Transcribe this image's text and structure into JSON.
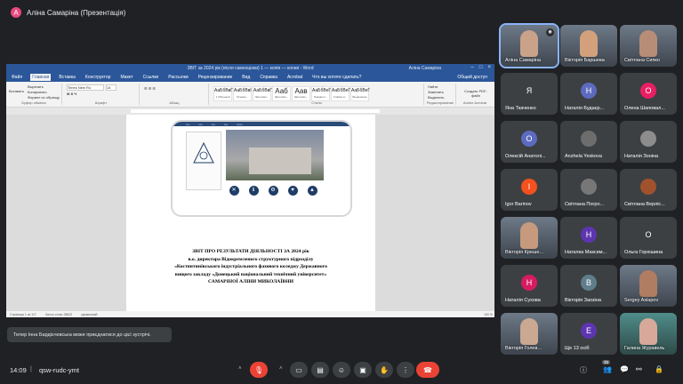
{
  "presenter": {
    "initial": "A",
    "label": "Аліна Самаріна (Презентація)"
  },
  "word": {
    "title": "ЗВІТ за 2024 рік (після самооцінки) 1 — копія — копия - Word",
    "account": "Аліна Самаріна",
    "tabs": [
      "Файл",
      "Главная",
      "Вставка",
      "Конструктор",
      "Макет",
      "Ссылки",
      "Рассылки",
      "Рецензирование",
      "Вид",
      "Справка",
      "Acrobat"
    ],
    "tell": "Что вы хотите сделать?",
    "share": "Общий доступ",
    "clipboard": {
      "paste": "Вставить",
      "cut": "Вырезать",
      "copy": "Копировать",
      "format": "Формат по образцу",
      "label": "Буфер обмена"
    },
    "font": {
      "name": "Times New Ro",
      "size": "14",
      "label": "Шрифт"
    },
    "paragraph_label": "Абзац",
    "styles": [
      {
        "sample": "АаБбВвГг",
        "name": "1 Обычный"
      },
      {
        "sample": "АаБбВвІ",
        "name": "Основн..."
      },
      {
        "sample": "АаБбВвГ",
        "name": "Заголово..."
      },
      {
        "sample": "Ааб",
        "name": "Заголово..."
      },
      {
        "sample": "Аав",
        "name": "Заголово..."
      },
      {
        "sample": "АаБбВеГ",
        "name": "Подзагол..."
      },
      {
        "sample": "АаБбВеГ",
        "name": "Слабое в..."
      },
      {
        "sample": "АаБбВеГ",
        "name": "Выделение"
      }
    ],
    "styles_label": "Стили",
    "editing": {
      "find": "Найти",
      "replace": "Заменить",
      "select": "Выделить",
      "label": "Редактирование"
    },
    "acrobat": {
      "create": "Создать PDF-файл",
      "label": "Adobe Acrobat"
    },
    "doc": {
      "lines": [
        "ЗВІТ ПРО РЕЗУЛЬТАТИ ДІЯЛЬНОСТІ ЗА 2024 рік",
        "в.о. директора Відокремленого структурного підрозділу",
        "«Костянтинівського індустріального фахового коледжу Державного",
        "вищого закладу «Донецький національний технічний університет»",
        "САМАРІНОЇ АЛІНИ МИКОЛАЇВНИ"
      ]
    },
    "status": {
      "page": "Страница 1 из 117",
      "words": "Число слов: 28622",
      "lang": "украинский",
      "zoom": "100 %"
    }
  },
  "participants": [
    {
      "name": "Аліна Самаріна",
      "initial": "",
      "color": "",
      "video": true,
      "active": true
    },
    {
      "name": "Вікторія Баршева",
      "initial": "",
      "color": "",
      "video": true,
      "active": false
    },
    {
      "name": "Світлана Сипко",
      "initial": "",
      "color": "",
      "video": true,
      "active": false
    },
    {
      "name": "Яна Ткаченко",
      "initial": "Я",
      "color": "#3c4043",
      "video": false
    },
    {
      "name": "Наталія Будаєр...",
      "initial": "Н",
      "color": "#5c6bc0",
      "video": false
    },
    {
      "name": "Олена Шаповал...",
      "initial": "О",
      "color": "#e91e63",
      "video": false
    },
    {
      "name": "Олексій Анатолі...",
      "initial": "О",
      "color": "#5c6bc0",
      "video": false
    },
    {
      "name": "Anzhela Yeskova",
      "initial": "",
      "color": "",
      "video": true
    },
    {
      "name": "Наталія Зоніна",
      "initial": "",
      "color": "",
      "video": true
    },
    {
      "name": "Igor Barinov",
      "initial": "I",
      "color": "#f4511e",
      "video": false
    },
    {
      "name": "Світлана Погро...",
      "initial": "",
      "color": "",
      "video": true
    },
    {
      "name": "Світлана Верліс...",
      "initial": "",
      "color": "",
      "video": true
    },
    {
      "name": "Вікторія Креше...",
      "initial": "",
      "color": "",
      "video": true
    },
    {
      "name": "Наталка Максим...",
      "initial": "Н",
      "color": "#5e35b1",
      "video": false
    },
    {
      "name": "Ольга Горюшина",
      "initial": "О",
      "color": "#3c4043",
      "video": false
    },
    {
      "name": "Наталія Сухова",
      "initial": "Н",
      "color": "#d81b60",
      "video": false
    },
    {
      "name": "Вікторія Заозіна",
      "initial": "В",
      "color": "#607d8b",
      "video": false
    },
    {
      "name": "Sergey Aslapov",
      "initial": "",
      "color": "",
      "video": true
    },
    {
      "name": "Вікторія Голев...",
      "initial": "",
      "color": "",
      "video": true
    },
    {
      "name": "Ще 13 осіб",
      "initial": "Е",
      "color": "#5e35b1",
      "video": false
    },
    {
      "name": "Галина Журавель",
      "initial": "",
      "color": "",
      "video": true
    }
  ],
  "toast": "Тепер Інна Бардієчевська може приєднатися до цієї зустрічі.",
  "bottom": {
    "time": "14:09",
    "separator": "|",
    "code": "qsw-rudc-ymt",
    "people_badge": "35"
  }
}
